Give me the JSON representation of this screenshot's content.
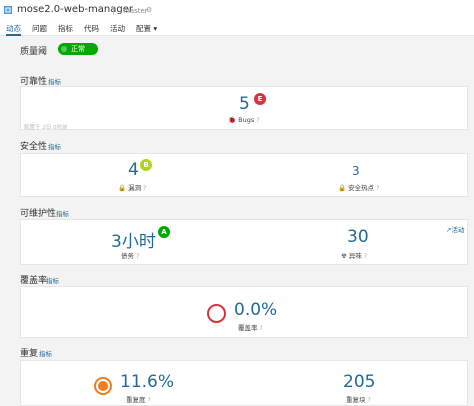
{
  "header": {
    "project_name": "mose2.0-web-manager",
    "separator": "|",
    "branch": "master",
    "settings_icon": "gear-icon"
  },
  "nav": {
    "tabs": [
      "动态",
      "问题",
      "指标",
      "代码",
      "活动",
      "配置"
    ],
    "active": "动态"
  },
  "quality_gate": {
    "title": "质量阈",
    "status": "正常",
    "status_color": "#00aa00"
  },
  "reliability": {
    "title": "可靠性",
    "link": "指标",
    "note": "配置于 2日 0时前",
    "bugs": {
      "value": "5",
      "grade": "E",
      "grade_color": "#d4333f",
      "label": "Bugs",
      "help": "?",
      "icon": "bug-icon"
    }
  },
  "security": {
    "title": "安全性",
    "link": "指标",
    "vulnerabilities": {
      "value": "4",
      "grade": "B",
      "grade_color": "#b0d513",
      "label": "漏洞",
      "help": "?",
      "icon": "lock-icon"
    },
    "hotspots": {
      "value": "3",
      "label": "安全热点",
      "help": "?",
      "icon": "lock-icon"
    }
  },
  "maintainability": {
    "title": "可维护性",
    "link": "指标",
    "activity": "活动",
    "debt": {
      "value": "3小时",
      "grade": "A",
      "grade_color": "#00aa00",
      "label": "债务",
      "help": "?"
    },
    "code_smells": {
      "value": "30",
      "label": "异味",
      "help": "?",
      "icon": "smell-icon"
    }
  },
  "coverage": {
    "title": "覆盖率",
    "link": "指标",
    "coverage": {
      "value": "0.0%",
      "label": "覆盖率",
      "help": "?",
      "ring_color": "#d4333f"
    }
  },
  "duplications": {
    "title": "重复",
    "link": "指标",
    "density": {
      "value": "11.6%",
      "label": "重复度",
      "help": "?",
      "ring_color": "#ed7d20"
    },
    "blocks": {
      "value": "205",
      "label": "重复块",
      "help": "?"
    }
  }
}
